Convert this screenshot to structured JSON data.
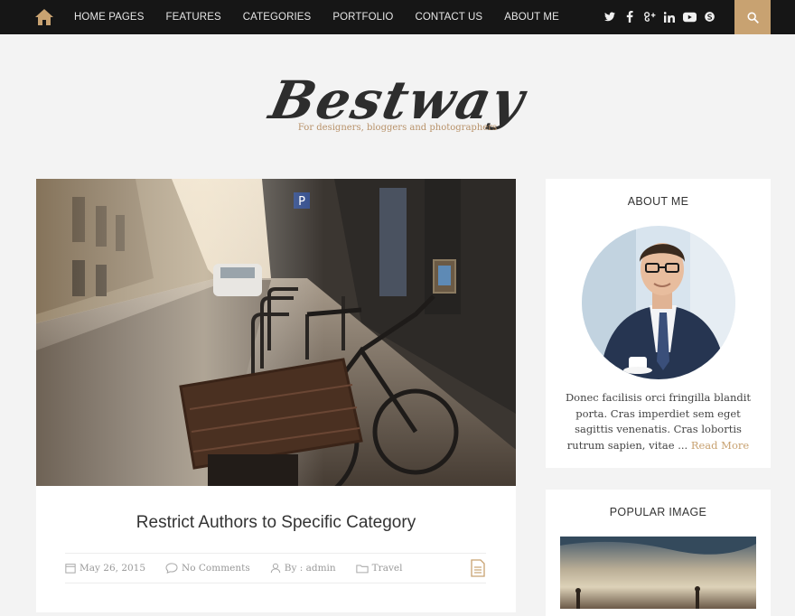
{
  "nav": {
    "home_icon": "home-icon",
    "items": [
      "HOME PAGES",
      "FEATURES",
      "CATEGORIES",
      "PORTFOLIO",
      "CONTACT US",
      "ABOUT ME"
    ],
    "social": [
      "twitter-icon",
      "facebook-icon",
      "google-plus-icon",
      "linkedin-icon",
      "youtube-icon",
      "skype-icon"
    ],
    "search_icon": "search-icon",
    "accent_color": "#c8a271",
    "bar_color": "#161616"
  },
  "header": {
    "title": "Bestway",
    "tagline": "For designers, bloggers and photographers"
  },
  "post": {
    "title": "Restrict Authors to Specific Category",
    "date": "May 26, 2015",
    "comments": "No Comments",
    "author": "By : admin",
    "category": "Travel"
  },
  "sidebar": {
    "about": {
      "title": "ABOUT ME",
      "text": "Donec facilisis orci fringilla blandit porta. Cras imperdiet sem eget sagittis venenatis. Cras lobortis rutrum sapien, vitae ...",
      "read_more": "Read More"
    },
    "popular": {
      "title": "POPULAR IMAGE"
    }
  }
}
